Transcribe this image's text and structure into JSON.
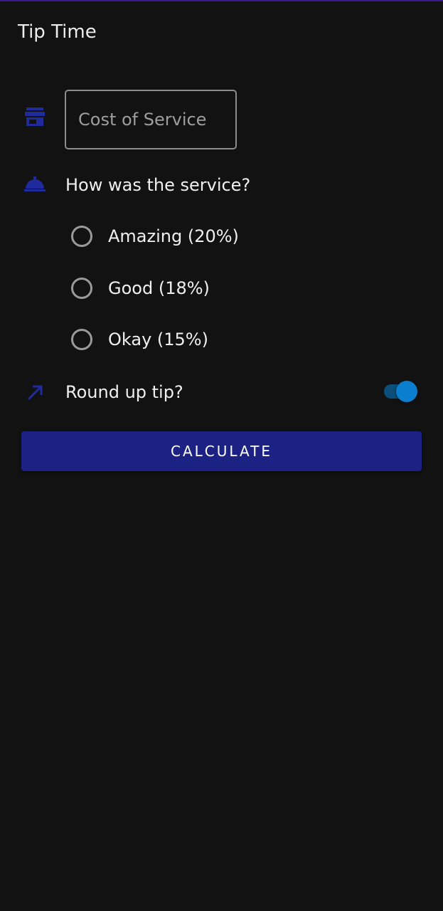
{
  "app": {
    "title": "Tip Time"
  },
  "cost_field": {
    "placeholder": "Cost of Service",
    "value": "",
    "icon": "storefront-icon"
  },
  "service": {
    "question": "How was the service?",
    "icon": "room-service-icon",
    "options": [
      {
        "label": "Amazing (20%)",
        "selected": false
      },
      {
        "label": "Good (18%)",
        "selected": false
      },
      {
        "label": "Okay (15%)",
        "selected": false
      }
    ]
  },
  "round_up": {
    "label": "Round up tip?",
    "icon": "round-up-arrow-icon",
    "enabled": true
  },
  "calculate_button": {
    "label": "CALCULATE"
  },
  "colors": {
    "background": "#121212",
    "icon_accent": "#1f2a9c",
    "button": "#1b2283",
    "switch_thumb": "#0a7fd0",
    "switch_track": "#0b4f7a"
  }
}
